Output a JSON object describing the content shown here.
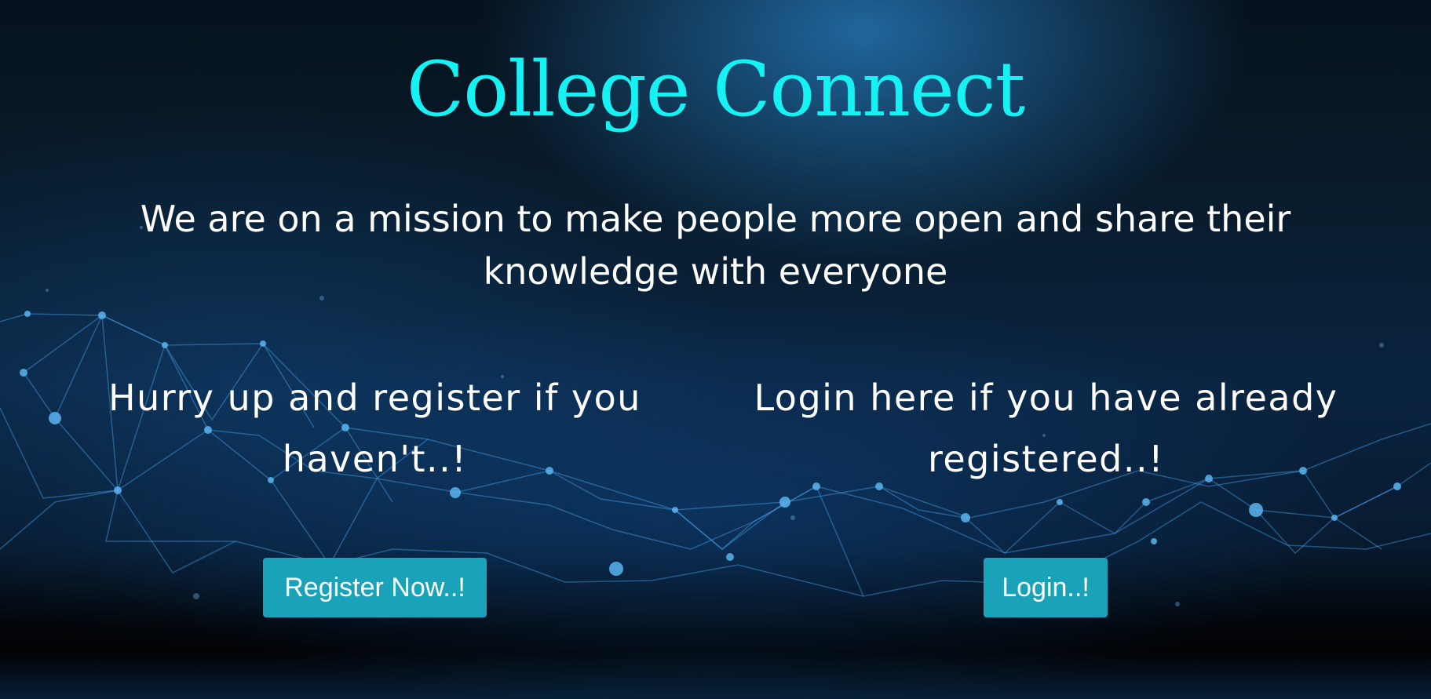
{
  "header": {
    "title": "College Connect"
  },
  "mission": {
    "text": "We are on a mission to make people more open and share their knowledge with everyone"
  },
  "register": {
    "prompt": "Hurry up and register if you haven't..!",
    "button_label": "Register Now..!"
  },
  "login": {
    "prompt": "Login here if you have already registered..!",
    "button_label": "Login..!"
  },
  "colors": {
    "title": "#16f1f4",
    "button": "#1aa2b8",
    "text": "#ffffff",
    "background": "#081c2d"
  }
}
